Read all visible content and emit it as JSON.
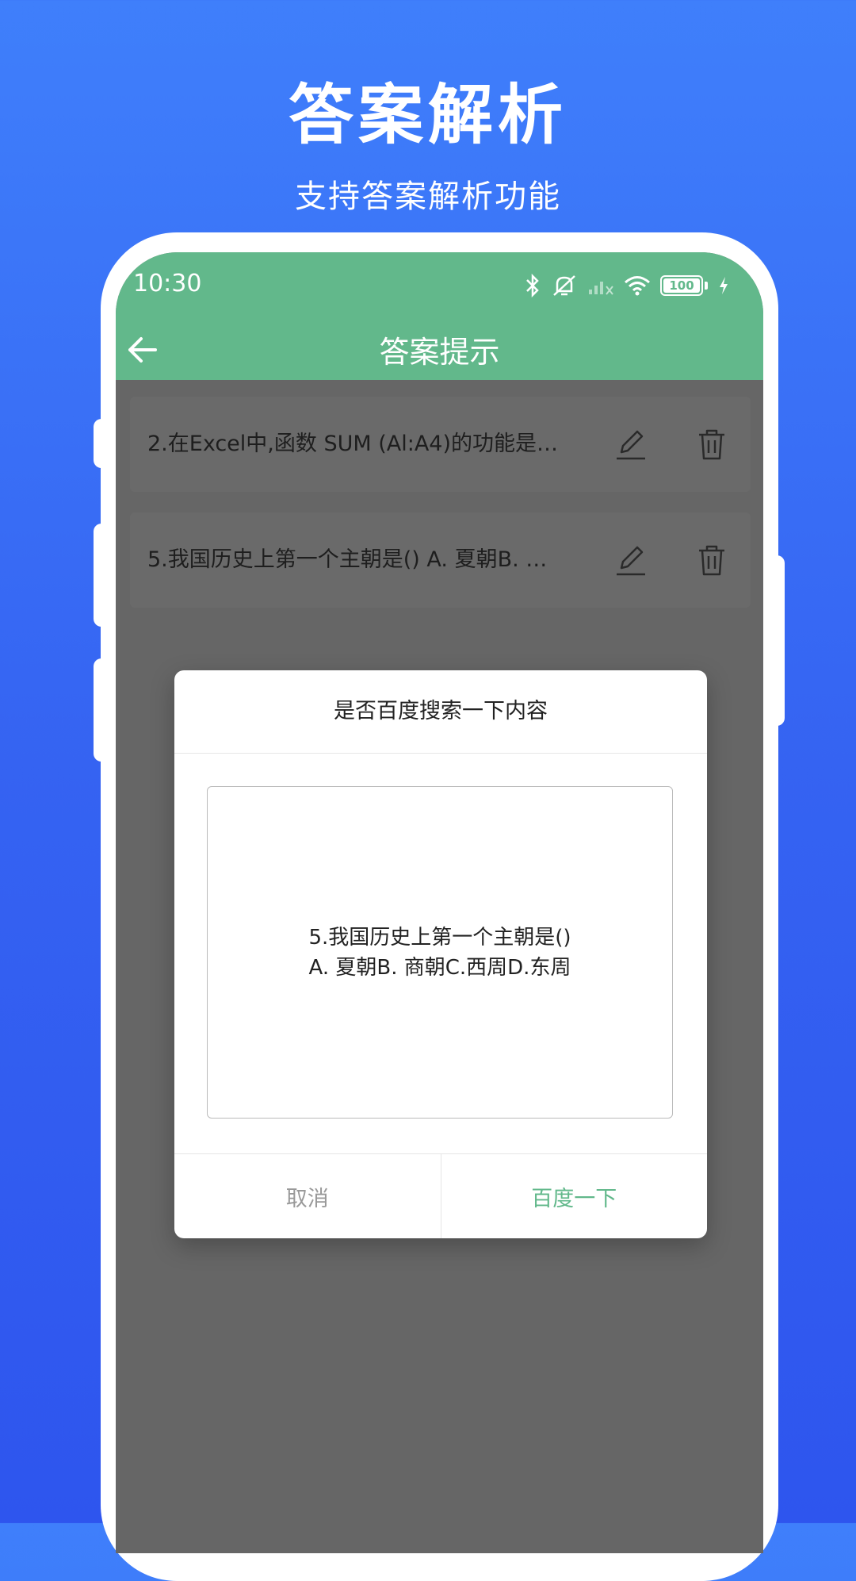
{
  "promo": {
    "title": "答案解析",
    "subtitle": "支持答案解析功能"
  },
  "status_bar": {
    "time": "10:30",
    "battery": "100"
  },
  "app_bar": {
    "title": "答案提示"
  },
  "list": {
    "items": [
      {
        "text": "2.在Excel中,函数 SUM (Al:A4)的功能是()..."
      },
      {
        "text": "5.我国历史上第一个主朝是() A. 夏朝B. 商..."
      }
    ]
  },
  "dialog": {
    "title": "是否百度搜索一下内容",
    "content_line1": "5.我国历史上第一个主朝是()",
    "content_line2": "A. 夏朝B. 商朝C.西周D.东周",
    "cancel_label": "取消",
    "confirm_label": "百度一下"
  },
  "colors": {
    "accent": "#62b88b",
    "background_top": "#3f7ffb",
    "background_bottom": "#2e55ee",
    "overlay": "#666666"
  },
  "icons": [
    "bluetooth-icon",
    "mute-icon",
    "signal-icon",
    "wifi-icon",
    "battery-icon",
    "charging-icon",
    "back-arrow-icon",
    "edit-icon",
    "trash-icon"
  ]
}
